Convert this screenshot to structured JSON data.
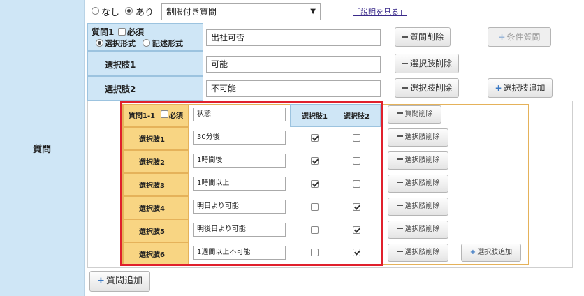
{
  "sidebar": {
    "label": "質問"
  },
  "top": {
    "radio_none": "なし",
    "radio_yes": "あり",
    "select_value": "制限付き質問",
    "help_link": "「説明を見る」"
  },
  "q1": {
    "title": "質問1",
    "required_label": "必須",
    "format_choice": "選択形式",
    "format_text": "記述形式",
    "value": "出社可否",
    "delete_button": "質問削除",
    "conditional_button": "条件質問"
  },
  "choices": [
    {
      "label": "選択肢1",
      "value": "可能",
      "delete": "選択肢削除"
    },
    {
      "label": "選択肢2",
      "value": "不可能",
      "delete": "選択肢削除",
      "add": "選択肢追加"
    }
  ],
  "sub": {
    "title": "質問1-1",
    "required_label": "必須",
    "value": "状態",
    "col1": "選択肢1",
    "col2": "選択肢2",
    "delete_button": "質問削除",
    "rows": [
      {
        "label": "選択肢1",
        "value": "30分後",
        "c1": true,
        "c2": false,
        "delete": "選択肢削除"
      },
      {
        "label": "選択肢2",
        "value": "1時間後",
        "c1": true,
        "c2": false,
        "delete": "選択肢削除"
      },
      {
        "label": "選択肢3",
        "value": "1時間以上",
        "c1": true,
        "c2": false,
        "delete": "選択肢削除"
      },
      {
        "label": "選択肢4",
        "value": "明日より可能",
        "c1": false,
        "c2": true,
        "delete": "選択肢削除"
      },
      {
        "label": "選択肢5",
        "value": "明後日より可能",
        "c1": false,
        "c2": true,
        "delete": "選択肢削除"
      },
      {
        "label": "選択肢6",
        "value": "1週間以上不可能",
        "c1": false,
        "c2": true,
        "delete": "選択肢削除",
        "add": "選択肢追加"
      }
    ]
  },
  "footer": {
    "add_question": "質問追加"
  }
}
